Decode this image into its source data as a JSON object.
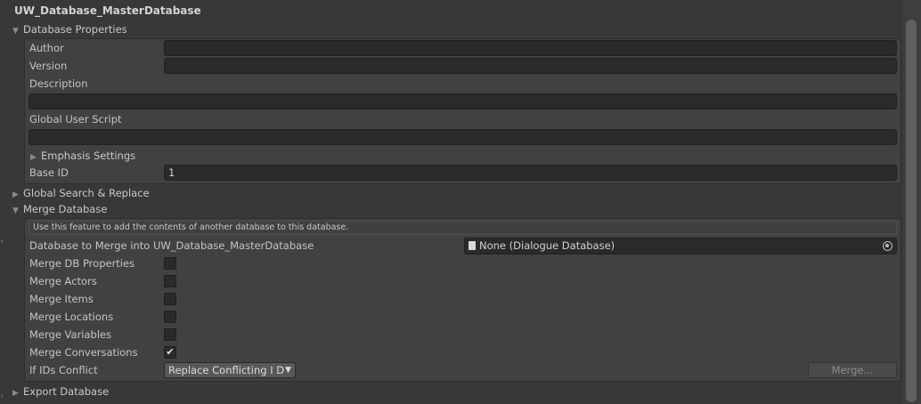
{
  "header": {
    "title": "UW_Database_MasterDatabase"
  },
  "database_properties": {
    "label": "Database Properties",
    "author_label": "Author",
    "author_value": "",
    "version_label": "Version",
    "version_value": "",
    "description_label": "Description",
    "description_value": "",
    "global_user_script_label": "Global User Script",
    "global_user_script_value": "",
    "emphasis_settings_label": "Emphasis Settings",
    "base_id_label": "Base ID",
    "base_id_value": "1"
  },
  "global_search_replace": {
    "label": "Global Search & Replace"
  },
  "merge_database": {
    "label": "Merge Database",
    "help_text": "Use this feature to add the contents of another database to this database.",
    "merge_into_label": "Database to Merge into UW_Database_MasterDatabase",
    "merge_into_value": "None (Dialogue Database)",
    "options": [
      {
        "label": "Merge DB Properties",
        "checked": false
      },
      {
        "label": "Merge Actors",
        "checked": false
      },
      {
        "label": "Merge Items",
        "checked": false
      },
      {
        "label": "Merge Locations",
        "checked": false
      },
      {
        "label": "Merge Variables",
        "checked": false
      },
      {
        "label": "Merge Conversations",
        "checked": true
      }
    ],
    "conflict_label": "If IDs Conflict",
    "conflict_value": "Replace Conflicting I D",
    "merge_button": "Merge..."
  },
  "export_database": {
    "label": "Export Database"
  },
  "icons": {
    "expanded": "triangle-down-icon",
    "collapsed": "triangle-right-icon",
    "check": "checkmark-icon",
    "object": "document-icon",
    "picker": "object-picker-icon"
  },
  "colors": {
    "background": "#383838",
    "panel": "#414141",
    "field": "#2a2a2a",
    "text": "#c4c4c4"
  }
}
